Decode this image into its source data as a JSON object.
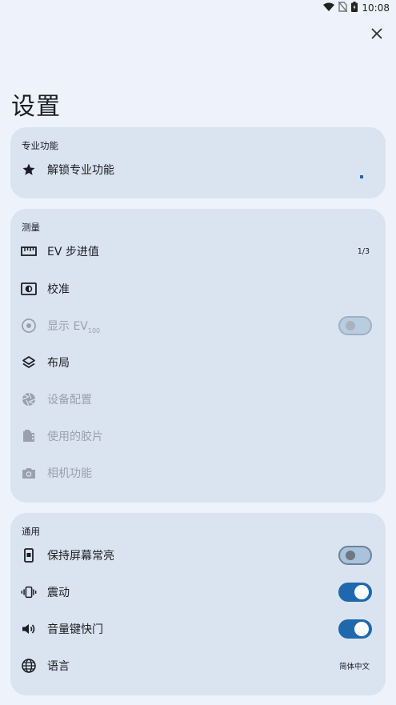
{
  "status_bar": {
    "time": "10:08"
  },
  "header": {
    "title": "设置"
  },
  "sections": {
    "pro": {
      "title": "专业功能",
      "items": [
        {
          "label": "解锁专业功能",
          "icon": "star-icon"
        }
      ]
    },
    "metering": {
      "title": "测量",
      "items": [
        {
          "label": "EV 步进值",
          "value": "1/3",
          "icon": "ruler-icon"
        },
        {
          "label": "校准",
          "icon": "calibration-icon"
        },
        {
          "label": "显示 EV",
          "label_sub": "100",
          "icon": "target-icon",
          "toggle": false,
          "enabled": false
        },
        {
          "label": "布局",
          "icon": "layers-icon"
        },
        {
          "label": "设备配置",
          "icon": "aperture-icon",
          "enabled": false
        },
        {
          "label": "使用的胶片",
          "icon": "film-icon",
          "enabled": false
        },
        {
          "label": "相机功能",
          "icon": "camera-icon",
          "enabled": false
        }
      ]
    },
    "general": {
      "title": "通用",
      "items": [
        {
          "label": "保持屏幕常亮",
          "icon": "phone-screen-icon",
          "toggle": false
        },
        {
          "label": "震动",
          "icon": "vibration-icon",
          "toggle": true
        },
        {
          "label": "音量键快门",
          "icon": "volume-icon",
          "toggle": true
        },
        {
          "label": "语言",
          "value": "简体中文",
          "icon": "globe-icon"
        }
      ]
    }
  },
  "colors": {
    "background": "#eef2fa",
    "card": "#dae4f0",
    "accent": "#1f68ad",
    "disabled_text": "#9aa1ab"
  }
}
